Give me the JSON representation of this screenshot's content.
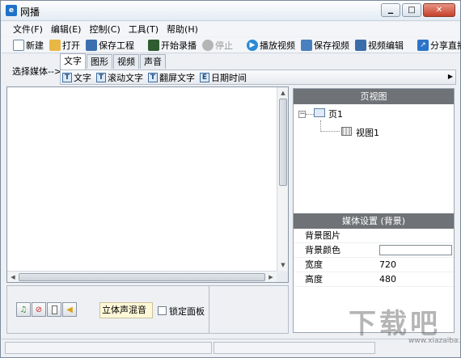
{
  "window": {
    "title": "网播",
    "controls": {
      "minimize": "▁",
      "maximize": "□",
      "close": "✕"
    }
  },
  "menu": {
    "items": [
      "文件(F)",
      "编辑(E)",
      "控制(C)",
      "工具(T)",
      "帮助(H)"
    ]
  },
  "toolbar": {
    "new_label": "新建",
    "open_label": "打开",
    "save_project_label": "保存工程",
    "start_record_label": "开始录播",
    "stop_label": "停止",
    "play_video_label": "播放视频",
    "save_video_label": "保存视频",
    "edit_video_label": "视频编辑",
    "share_live_label": "分享直播"
  },
  "media": {
    "select_label": "选择媒体-->",
    "tabs": [
      "文字",
      "图形",
      "视频",
      "声音"
    ],
    "active_tab": "文字",
    "buttons": [
      "文字",
      "滚动文字",
      "翻屏文字",
      "日期时间"
    ]
  },
  "page_view": {
    "header": "页视图",
    "page_label": "页1",
    "view_label": "视图1",
    "expander": "−"
  },
  "media_settings": {
    "header": "媒体设置 (背景)",
    "rows": [
      {
        "name": "背景图片",
        "value": ""
      },
      {
        "name": "背景颜色",
        "value": ""
      },
      {
        "name": "宽度",
        "value": "720"
      },
      {
        "name": "高度",
        "value": "480"
      }
    ]
  },
  "bottom": {
    "stereo_label": "立体声混音",
    "lock_label": "锁定面板"
  },
  "watermark": {
    "logo_text": "下载吧",
    "url": "www.xiazaiba.com"
  },
  "colors": {
    "panel_header": "#6f7276",
    "accent": "#1e73c9",
    "stereo_bg": "#fff8d8"
  }
}
